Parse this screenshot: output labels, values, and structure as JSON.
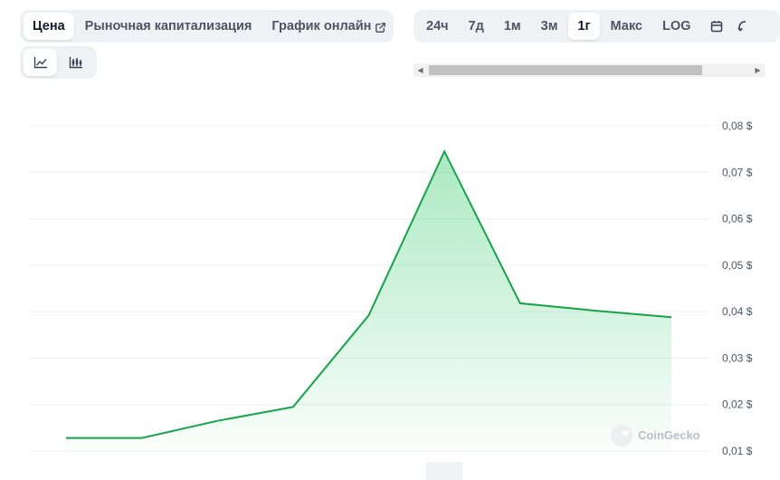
{
  "metric_tabs": [
    {
      "label": "Цена",
      "active": true
    },
    {
      "label": "Рыночная капитализация",
      "active": false
    },
    {
      "label": "График онлайн",
      "active": false
    }
  ],
  "range_tabs": [
    {
      "label": "24ч",
      "active": false
    },
    {
      "label": "7д",
      "active": false
    },
    {
      "label": "1м",
      "active": false
    },
    {
      "label": "3м",
      "active": false
    },
    {
      "label": "1г",
      "active": true
    },
    {
      "label": "Макс",
      "active": false
    },
    {
      "label": "LOG",
      "active": false
    }
  ],
  "icons": {
    "external_link": "external-link-icon",
    "calendar": "calendar-icon",
    "cutoff": "refresh-icon",
    "line_chart": "line-chart-icon",
    "candlestick": "candlestick-icon"
  },
  "colors": {
    "line": "#16a34a",
    "fill_top": "#22c55e",
    "grid": "#eef0f3",
    "accent_bg": "#eff2f5"
  },
  "watermark": "CoinGecko",
  "chart_data": {
    "type": "area",
    "x": [
      0,
      1,
      2,
      3,
      4,
      5,
      6,
      7,
      8
    ],
    "values": [
      0.0128,
      0.0128,
      0.0165,
      0.0195,
      0.0392,
      0.0745,
      0.0418,
      0.0402,
      0.0388
    ],
    "ylim": [
      0.01,
      0.08
    ],
    "yticks": [
      0.01,
      0.02,
      0.03,
      0.04,
      0.05,
      0.06,
      0.07,
      0.08
    ],
    "ytick_labels": [
      "0,01 $",
      "0,02 $",
      "0,03 $",
      "0,04 $",
      "0,05 $",
      "0,06 $",
      "0,07 $",
      "0,08 $"
    ],
    "grid": true,
    "title": "",
    "xlabel": "",
    "ylabel": ""
  }
}
